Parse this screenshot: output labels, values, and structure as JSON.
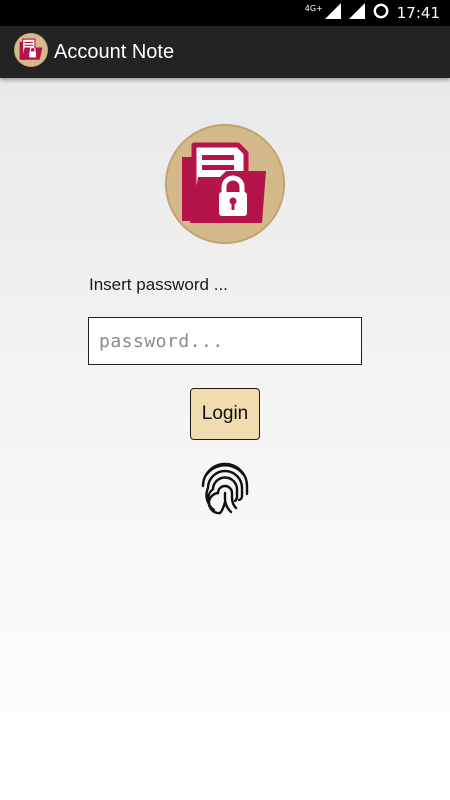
{
  "status_bar": {
    "network": "4G+",
    "time": "17:41"
  },
  "app_bar": {
    "title": "Account Note"
  },
  "login": {
    "prompt": "Insert password ...",
    "password_placeholder": "password...",
    "button_label": "Login"
  },
  "colors": {
    "logo_circle": "#d4b98a",
    "logo_accent": "#b5144a",
    "button_bg": "#f1dcb0",
    "app_bar": "#232323"
  },
  "icons": {
    "app_logo": "folder-lock-icon",
    "fingerprint": "fingerprint-icon",
    "signal": "signal-icon",
    "wifi": "wifi-icon",
    "battery": "battery-ring-icon"
  }
}
